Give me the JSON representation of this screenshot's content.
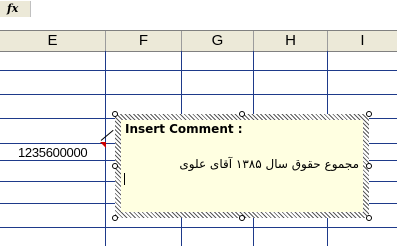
{
  "formula_bar": {
    "fx_label": "fx"
  },
  "columns": [
    "E",
    "F",
    "G",
    "H",
    "I"
  ],
  "cell": {
    "value": "1235600000"
  },
  "comment": {
    "title": "Insert Comment :",
    "text": "مجموع حقوق سال ۱۳۸۵ آقای علوی"
  },
  "colors": {
    "header_bg": "#ece9d8",
    "gridline": "#1e3a8a",
    "comment_bg": "#ffffe1",
    "comment_indicator": "#cc0000"
  }
}
